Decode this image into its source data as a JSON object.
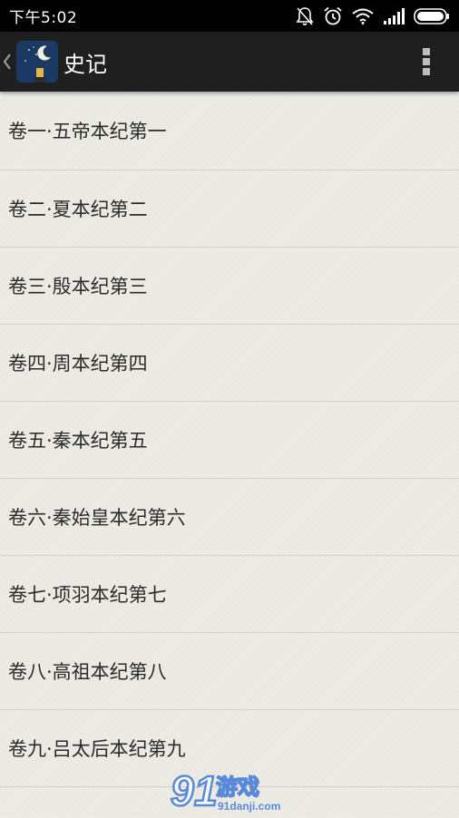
{
  "status_bar": {
    "time": "下午5:02",
    "icons": [
      "notifications-off-icon",
      "alarm-icon",
      "wifi-icon",
      "signal-icon",
      "battery-icon"
    ]
  },
  "action_bar": {
    "title": "史记",
    "icons": [
      "back-chevron-icon",
      "app-icon",
      "overflow-menu-icon"
    ]
  },
  "chapters": [
    "卷一·五帝本纪第一",
    "卷二·夏本纪第二",
    "卷三·殷本纪第三",
    "卷四·周本纪第四",
    "卷五·秦本纪第五",
    "卷六·秦始皇本纪第六",
    "卷七·项羽本纪第七",
    "卷八·高祖本纪第八",
    "卷九·吕太后本纪第九"
  ],
  "watermark": {
    "logo": "91游戏",
    "site": "91danji.com"
  },
  "colors": {
    "status_bar_bg": "#000000",
    "action_bar_bg": "#1f1f1f",
    "list_bg": "#ecebe4",
    "divider": "#d2d0c6",
    "item_text": "#2b2b2b",
    "app_icon_bg": "#1b3a63"
  }
}
